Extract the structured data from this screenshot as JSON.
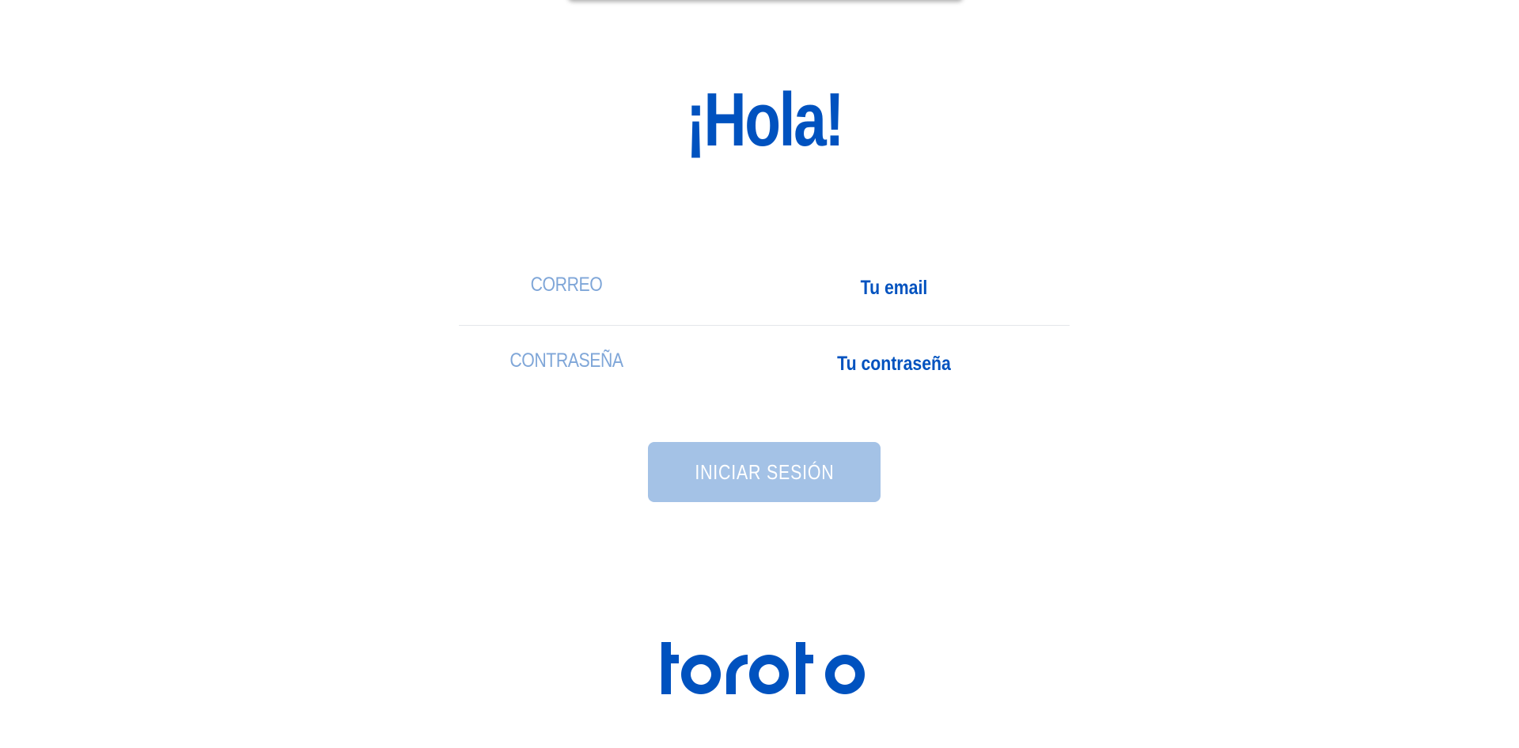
{
  "greeting": "¡Hola!",
  "form": {
    "email": {
      "label": "CORREO",
      "placeholder": "Tu email"
    },
    "password": {
      "label": "CONTRASEÑA",
      "placeholder": "Tu contraseña"
    },
    "submit_label": "INICIAR SESIÓN"
  },
  "logo": {
    "name": "toroto",
    "icon": "toroto-logo"
  },
  "colors": {
    "brand_blue": "#0052bf",
    "label_blue": "#7fa6d8",
    "button_disabled": "#a4c2e6",
    "divider": "#e3e6ea",
    "background": "#ffffff"
  }
}
